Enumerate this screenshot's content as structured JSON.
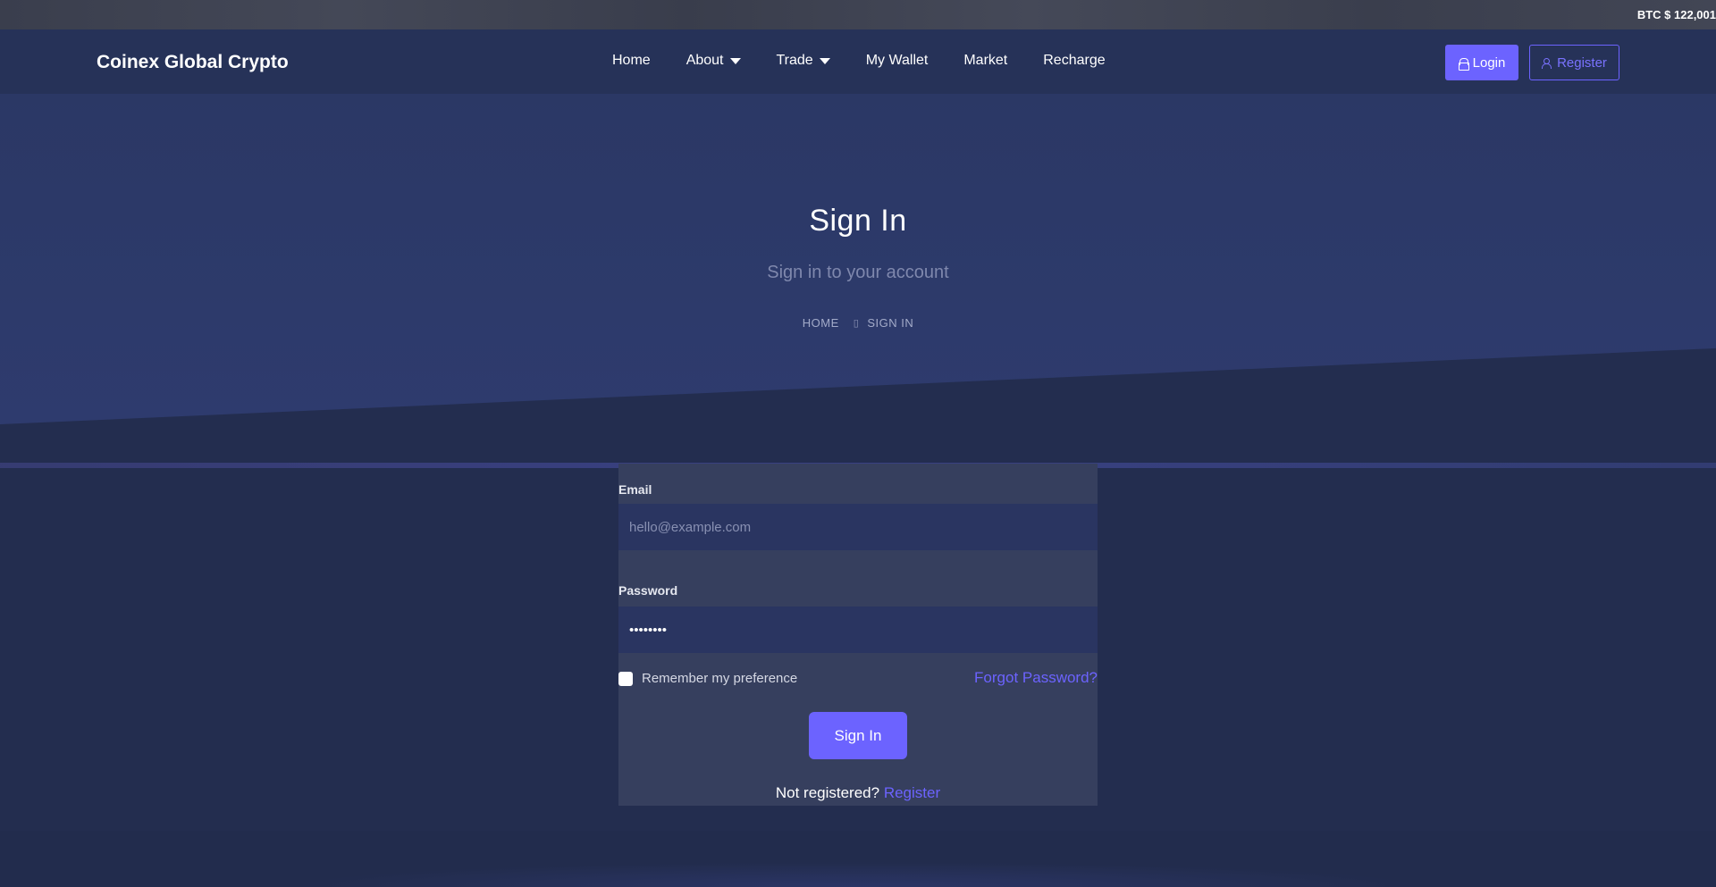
{
  "ticker": {
    "text": "BTC $ 122,001"
  },
  "navbar": {
    "brand": "Coinex Global Crypto",
    "items": [
      {
        "label": "Home",
        "dropdown": false
      },
      {
        "label": "About",
        "dropdown": true
      },
      {
        "label": "Trade",
        "dropdown": true
      },
      {
        "label": "My Wallet",
        "dropdown": false
      },
      {
        "label": "Market",
        "dropdown": false
      },
      {
        "label": "Recharge",
        "dropdown": false
      }
    ],
    "login_label": "Login",
    "register_label": "Register"
  },
  "hero": {
    "title": "Sign In",
    "subtitle": "Sign in to your account",
    "breadcrumb": {
      "home": "HOME",
      "current": "SIGN IN"
    }
  },
  "form": {
    "email_label": "Email",
    "email_placeholder": "hello@example.com",
    "email_value": "",
    "password_label": "Password",
    "password_value": "password",
    "remember_label": "Remember my preference",
    "forgot_label": "Forgot Password?",
    "submit_label": "Sign In",
    "not_registered": "Not registered?",
    "register_link": "Register"
  },
  "colors": {
    "accent": "#6c63ff",
    "background": "#232d4f",
    "navbar": "#263258",
    "card": "#363f5e",
    "input": "#2a3561"
  }
}
